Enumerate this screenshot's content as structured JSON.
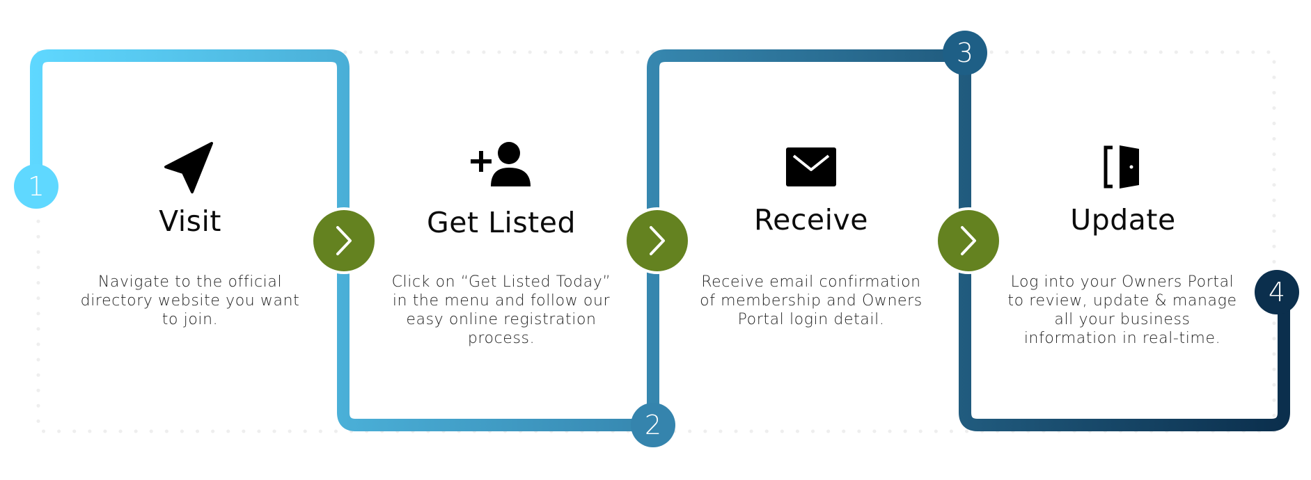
{
  "colors": {
    "path_start": "#5fd8ff",
    "path_mid": "#3a8fb8",
    "path_end": "#0b2f4d",
    "arrow_badge": "#648220",
    "dots": "#eeeeee",
    "text": "#0b0b0b"
  },
  "steps": [
    {
      "number": "1",
      "title": "Visit",
      "description": "Navigate to the official directory website you want to join.",
      "icon": "navigation-arrow-icon"
    },
    {
      "number": "2",
      "title": "Get Listed",
      "description": "Click on “Get Listed Today” in the menu and follow our easy online registration process.",
      "icon": "add-user-icon"
    },
    {
      "number": "3",
      "title": "Receive",
      "description": "Receive email confirmation of membership and Owners Portal login detail.",
      "icon": "envelope-icon"
    },
    {
      "number": "4",
      "title": "Update",
      "description": "Log into your Owners Portal to review, update & manage all your business information in real-time.",
      "icon": "door-enter-icon"
    }
  ],
  "connectors": [
    "chevron-right-icon",
    "chevron-right-icon",
    "chevron-right-icon"
  ]
}
